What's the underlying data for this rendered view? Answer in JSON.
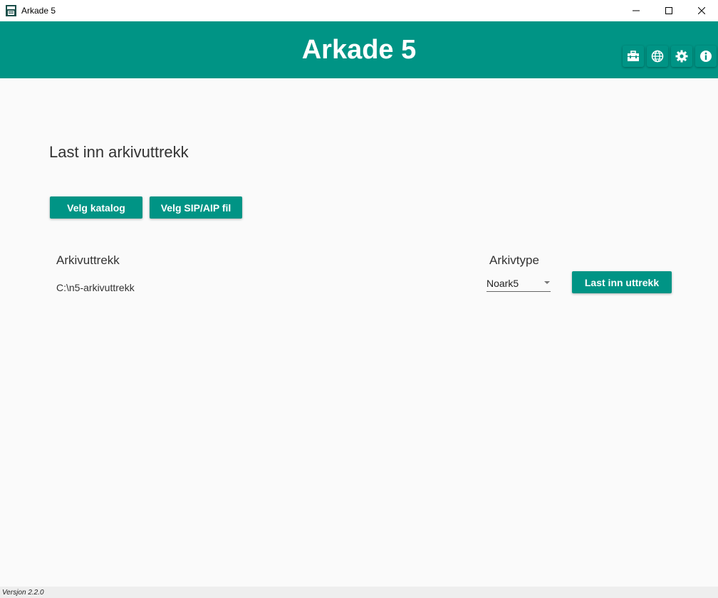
{
  "window": {
    "title": "Arkade 5"
  },
  "header": {
    "title": "Arkade 5",
    "buttons": [
      {
        "icon": "toolbox-icon"
      },
      {
        "icon": "globe-icon"
      },
      {
        "icon": "gear-icon"
      },
      {
        "icon": "info-icon"
      }
    ]
  },
  "main": {
    "heading": "Last inn arkivuttrekk",
    "velg_katalog_label": "Velg katalog",
    "velg_sip_label": "Velg SIP/AIP fil",
    "arkivuttrekk_label": "Arkivuttrekk",
    "arkivuttrekk_path": "C:\\n5-arkivuttrekk",
    "arkivtype_label": "Arkivtype",
    "arkivtype_selected": "Noark5",
    "last_inn_label": "Last inn uttrekk"
  },
  "footer": {
    "version_label": "Versjon",
    "version_number": "2.2.0"
  },
  "colors": {
    "accent": "#009485",
    "background": "#fafafa",
    "text": "#333333"
  }
}
